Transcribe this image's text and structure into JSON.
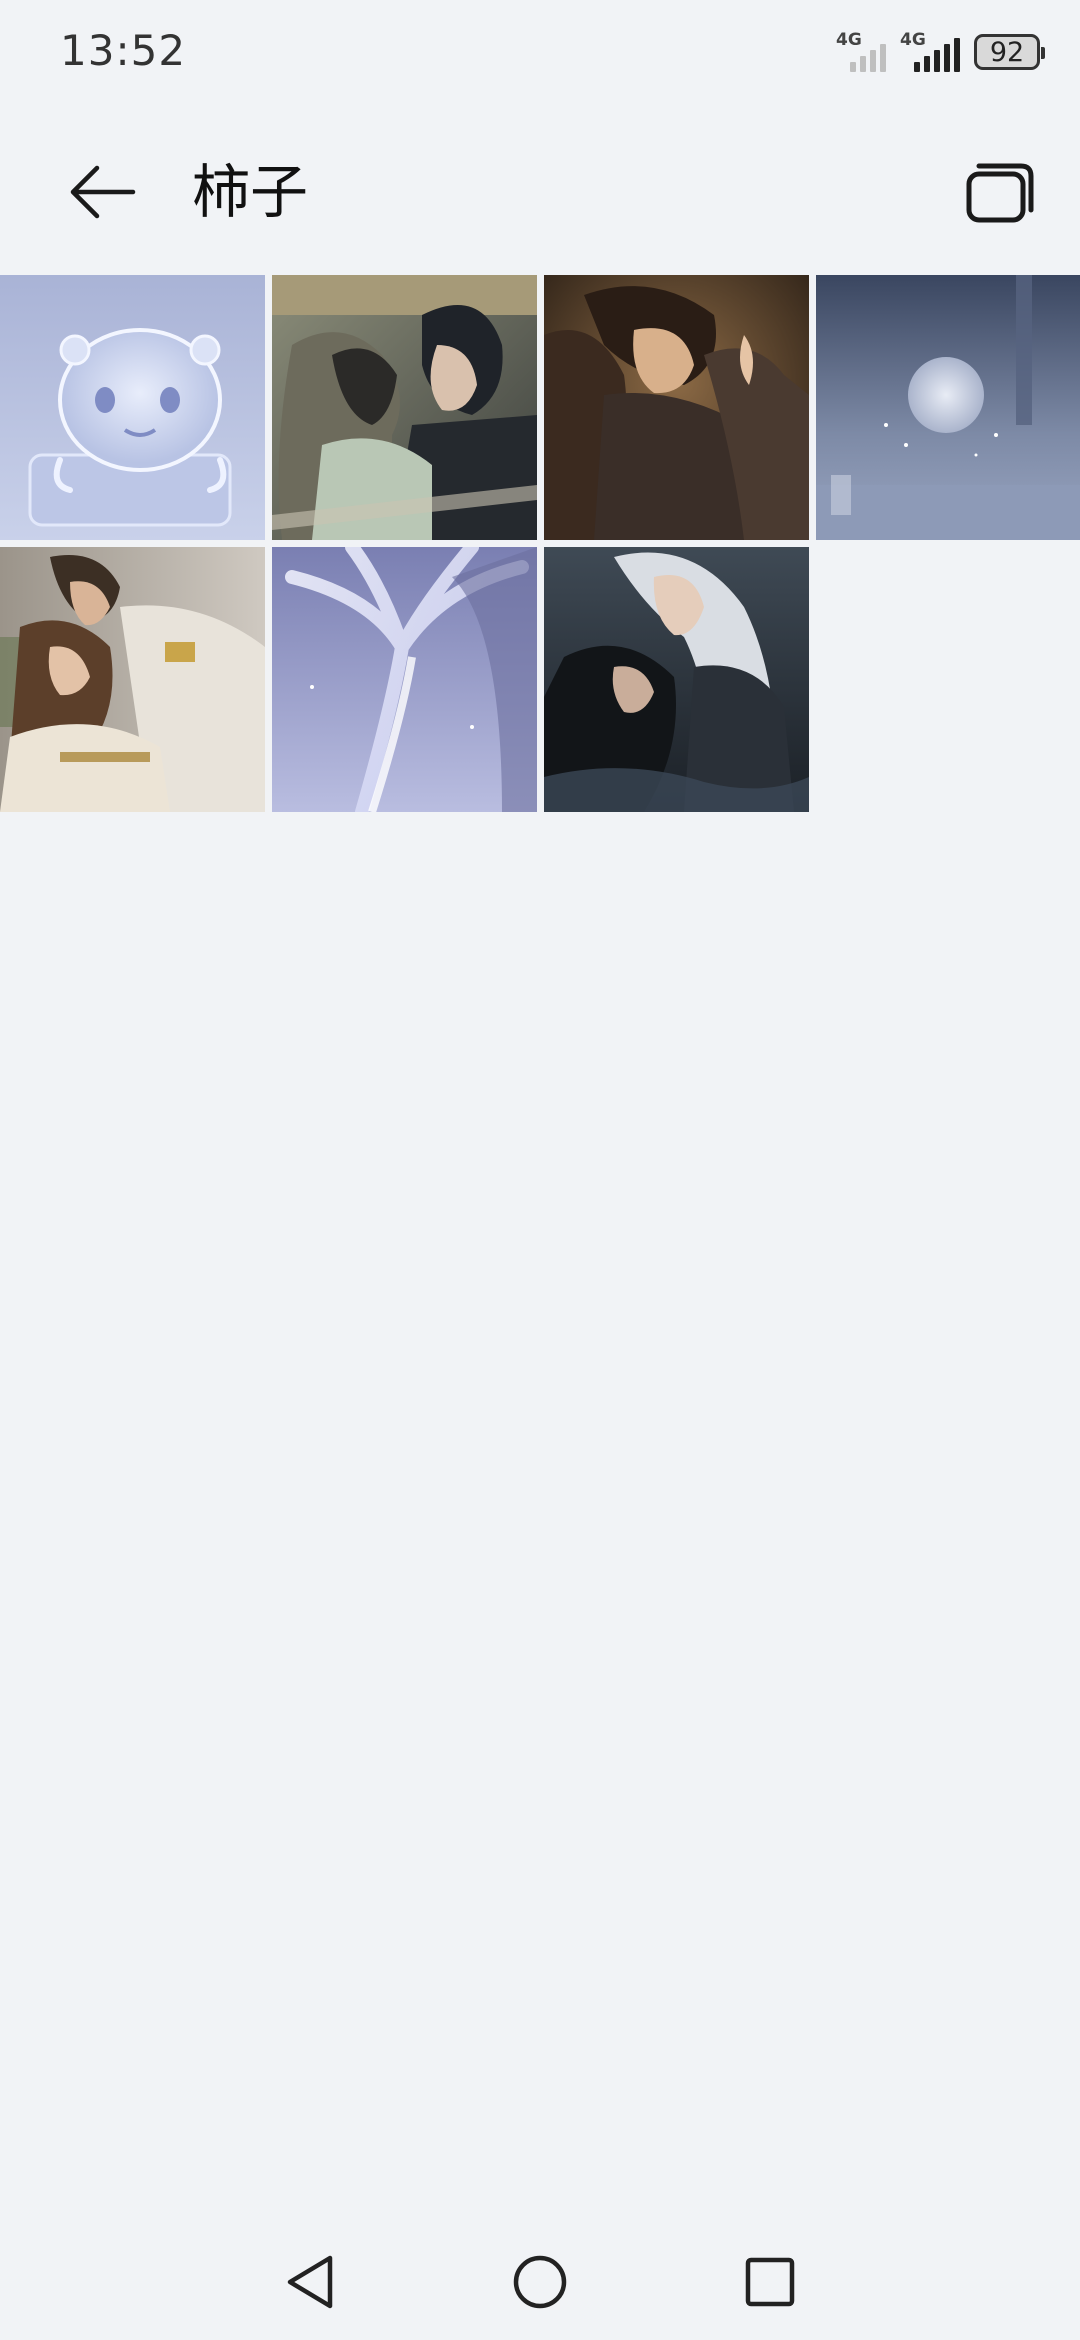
{
  "status_bar": {
    "time": "13:52",
    "network_1": "4G",
    "network_2": "4G",
    "battery": "92"
  },
  "header": {
    "title": "柿子",
    "back_icon": "arrow-left-icon",
    "action_icon": "multi-window-icon"
  },
  "photos": [
    {
      "name": "photo-1",
      "description_icon": "jelly-bear-figure"
    },
    {
      "name": "photo-2",
      "description_icon": "couple-kiss-illustration"
    },
    {
      "name": "photo-3",
      "description_icon": "couple-embrace-illustration"
    },
    {
      "name": "photo-4",
      "description_icon": "moon-fog-scene"
    },
    {
      "name": "photo-5",
      "description_icon": "couple-white-coat-illustration"
    },
    {
      "name": "photo-6",
      "description_icon": "light-tree-scene"
    },
    {
      "name": "photo-7",
      "description_icon": "couple-dark-water-illustration"
    }
  ],
  "navigation": {
    "back_icon": "triangle-back-icon",
    "home_icon": "circle-home-icon",
    "recents_icon": "square-recents-icon"
  },
  "colors": {
    "background": "#f1f3f6",
    "text": "#111111"
  }
}
